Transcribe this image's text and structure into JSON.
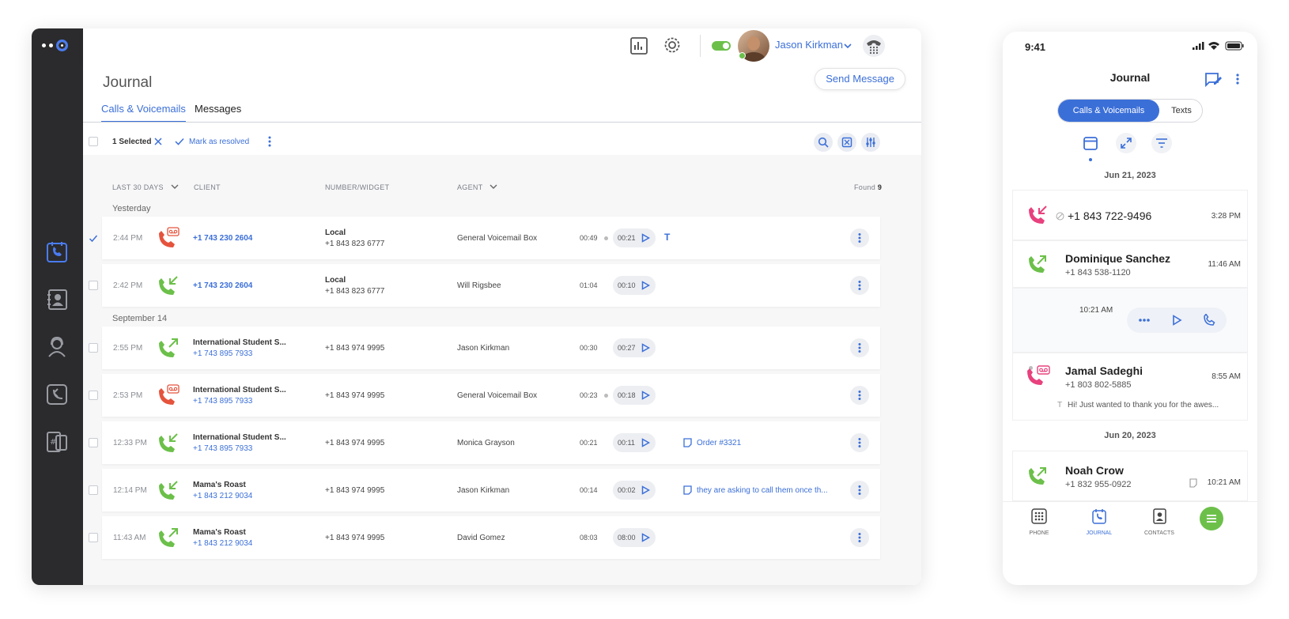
{
  "desktop": {
    "topbar": {
      "user_name": "Jason Kirkman"
    },
    "journal_title": "Journal",
    "send_message_label": "Send Message",
    "tabs": [
      {
        "label": "Calls & Voicemails",
        "active": true
      },
      {
        "label": "Messages",
        "active": false
      }
    ],
    "toolbar": {
      "selected_label": "1 Selected",
      "mark_resolved_label": "Mark as resolved"
    },
    "columns": {
      "date": "LAST 30 DAYS",
      "client": "CLIENT",
      "number": "NUMBER/WIDGET",
      "agent": "AGENT",
      "found_label": "Found",
      "found_count": "9"
    },
    "groups": [
      {
        "label": "Yesterday"
      },
      {
        "label": "September 14"
      }
    ],
    "rows": [
      {
        "time": "2:44 PM",
        "type": "voicemail",
        "client_name": "",
        "client_number": "+1 743 230 2604",
        "num_label": "Local",
        "num_value": "+1 843 823 6777",
        "agent": "General Voicemail Box",
        "duration": "00:49",
        "playback": "00:21",
        "note": "",
        "checked": true
      },
      {
        "time": "2:42 PM",
        "type": "incoming",
        "client_name": "",
        "client_number": "+1 743 230 2604",
        "num_label": "Local",
        "num_value": "+1 843 823 6777",
        "agent": "Will Rigsbee",
        "duration": "01:04",
        "playback": "00:10",
        "note": "",
        "checked": false
      },
      {
        "time": "2:55 PM",
        "type": "outgoing",
        "client_name": "International Student S...",
        "client_number": "+1 743 895 7933",
        "num_label": "",
        "num_value": "+1 843 974 9995",
        "agent": "Jason Kirkman",
        "duration": "00:30",
        "playback": "00:27",
        "note": "",
        "checked": false
      },
      {
        "time": "2:53 PM",
        "type": "voicemail",
        "client_name": "International Student S...",
        "client_number": "+1 743 895 7933",
        "num_label": "",
        "num_value": "+1 843 974 9995",
        "agent": "General Voicemail Box",
        "duration": "00:23",
        "playback": "00:18",
        "note": "",
        "checked": false
      },
      {
        "time": "12:33 PM",
        "type": "incoming",
        "client_name": "International Student S...",
        "client_number": "+1 743 895 7933",
        "num_label": "",
        "num_value": "+1 843 974 9995",
        "agent": "Monica Grayson",
        "duration": "00:21",
        "playback": "00:11",
        "note": "Order #3321",
        "checked": false
      },
      {
        "time": "12:14 PM",
        "type": "incoming",
        "client_name": "Mama's Roast",
        "client_number": "+1 843 212 9034",
        "num_label": "",
        "num_value": "+1 843 974 9995",
        "agent": "Jason Kirkman",
        "duration": "00:14",
        "playback": "00:02",
        "note": "they are asking to call them once th...",
        "checked": false
      },
      {
        "time": "11:43 AM",
        "type": "outgoing",
        "client_name": "Mama's Roast",
        "client_number": "+1 843 212 9034",
        "num_label": "",
        "num_value": "+1 843 974 9995",
        "agent": "David Gomez",
        "duration": "08:03",
        "playback": "08:00",
        "note": "",
        "checked": false
      }
    ]
  },
  "mobile": {
    "status_time": "9:41",
    "title": "Journal",
    "segment_active": "Calls & Voicemails",
    "segment_inactive": "Texts",
    "dates": [
      "Jun 21, 2023",
      "Jun 20, 2023"
    ],
    "items": [
      {
        "type": "missed",
        "name": "+1 843 722-9496",
        "number": "",
        "time": "3:28 PM"
      },
      {
        "type": "outgoing",
        "name": "Dominique Sanchez",
        "number": "+1 843 538-1120",
        "time": "11:46 AM"
      },
      {
        "type": "expanded",
        "time": "10:21 AM"
      },
      {
        "type": "voicemail",
        "name": "Jamal Sadeghi",
        "number": "+1 803 802-5885",
        "time": "8:55 AM",
        "transcript": "Hi! Just wanted to thank you for the awes..."
      },
      {
        "type": "outgoing",
        "name": "Noah Crow",
        "number": "+1 832 955-0922",
        "time": "10:21 AM"
      }
    ],
    "nav": [
      {
        "label": "PHONE"
      },
      {
        "label": "JOURNAL"
      },
      {
        "label": "CONTACTS"
      }
    ],
    "colors": {
      "accent": "#3b6fd8",
      "green": "#6cc04a",
      "red": "#e5533d",
      "pink": "#e8417d"
    }
  }
}
